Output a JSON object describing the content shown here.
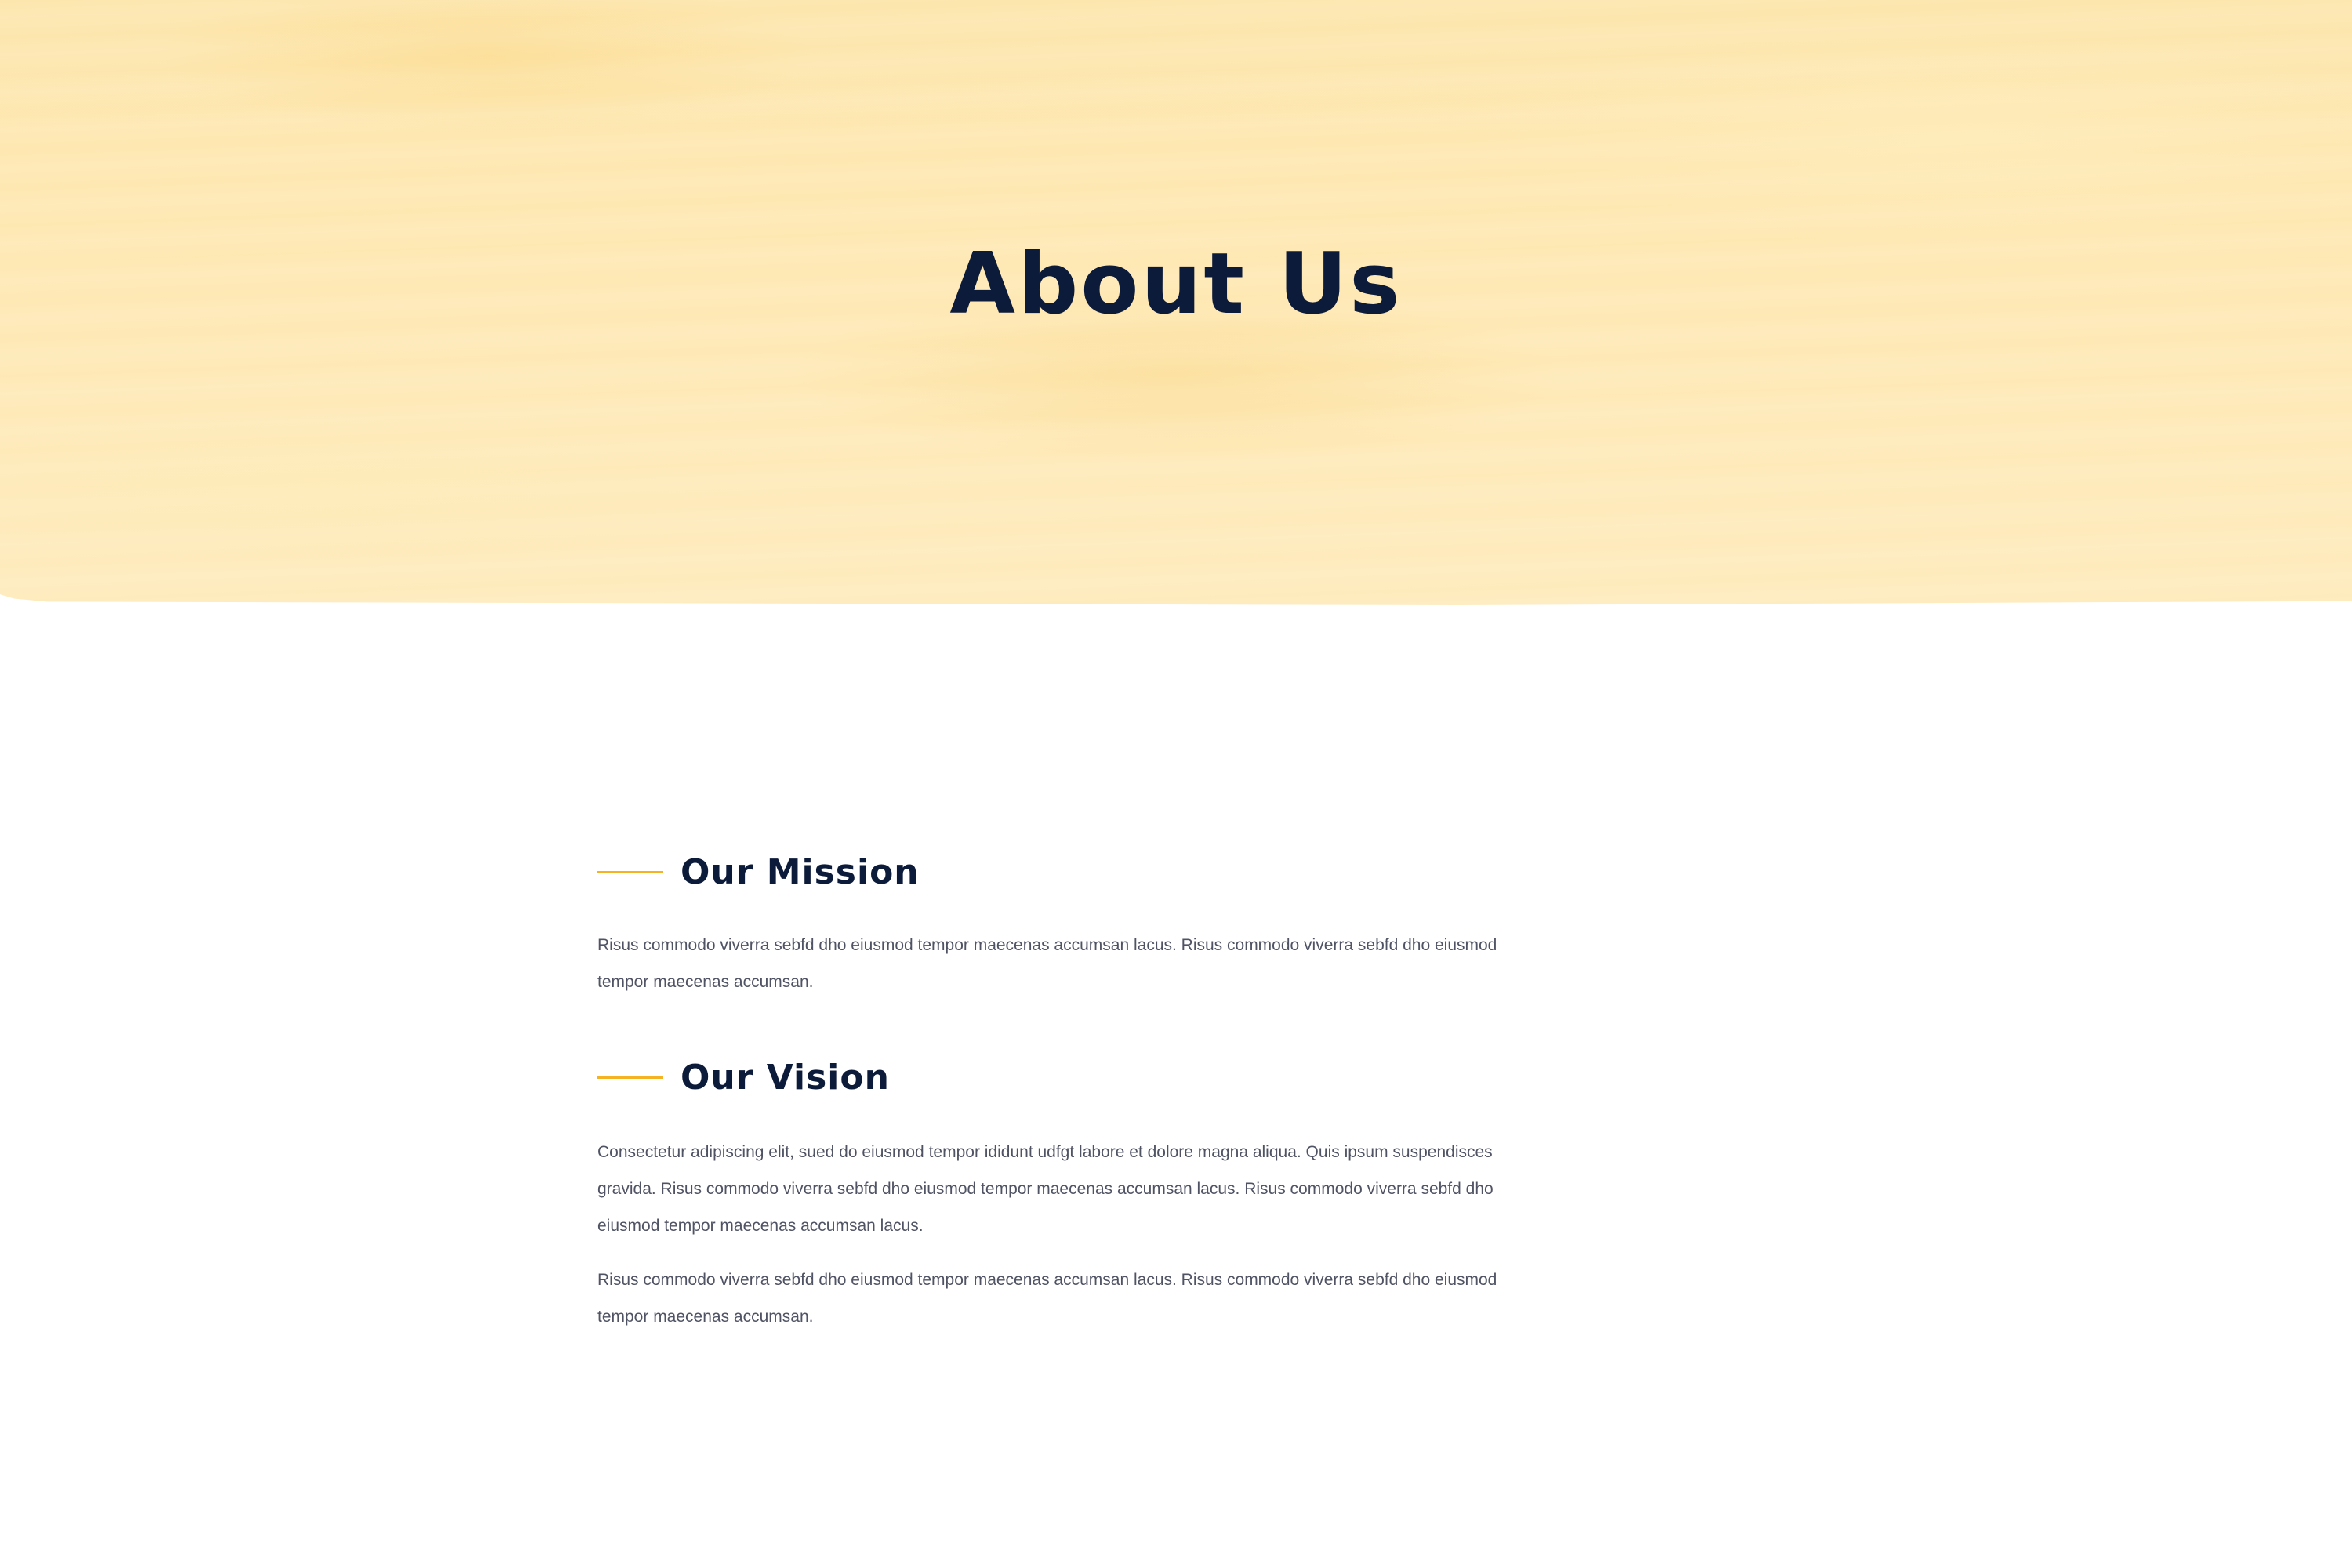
{
  "hero": {
    "title": "About Us"
  },
  "mission": {
    "heading": "Our Mission",
    "paragraph": "Risus commodo viverra sebfd dho eiusmod tempor maecenas accumsan lacus. Risus commodo viverra sebfd dho eiusmod tempor maecenas accumsan."
  },
  "vision": {
    "heading": "Our Vision",
    "paragraphs": [
      "Consectetur adipiscing elit, sued do eiusmod tempor ididunt udfgt labore et dolore magna aliqua. Quis ipsum suspendisces gravida. Risus commodo viverra sebfd dho eiusmod tempor maecenas accumsan lacus. Risus commodo viverra sebfd dho eiusmod tempor maecenas accumsan lacus.",
      "Risus commodo viverra sebfd dho eiusmod tempor maecenas accumsan lacus. Risus commodo viverra sebfd dho eiusmod tempor maecenas accumsan."
    ]
  },
  "colors": {
    "accent": "#f5b324",
    "heading": "#0d1b3a",
    "body_text": "#4f5364",
    "hero_background": "#fee8b3"
  }
}
